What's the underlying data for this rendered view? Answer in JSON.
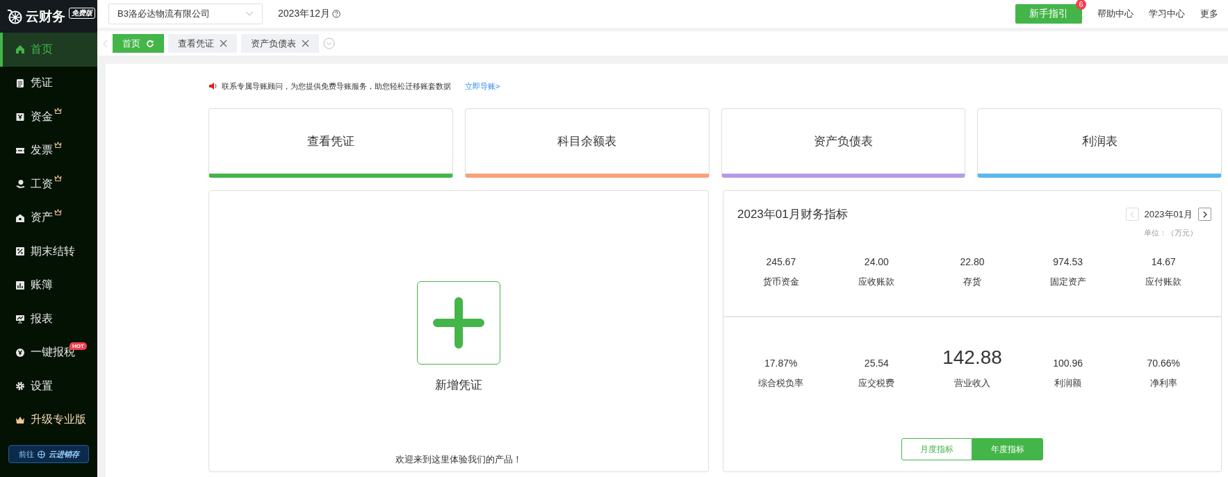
{
  "sidebar": {
    "logo_text": "云财务",
    "edition_badge": "免费版",
    "items": [
      {
        "label": "首页",
        "selected": true,
        "premium": false
      },
      {
        "label": "凭证",
        "selected": false,
        "premium": false
      },
      {
        "label": "资金",
        "selected": false,
        "premium": true
      },
      {
        "label": "发票",
        "selected": false,
        "premium": true
      },
      {
        "label": "工资",
        "selected": false,
        "premium": true
      },
      {
        "label": "资产",
        "selected": false,
        "premium": true
      },
      {
        "label": "期末结转",
        "selected": false,
        "premium": false
      },
      {
        "label": "账簿",
        "selected": false,
        "premium": false
      },
      {
        "label": "报表",
        "selected": false,
        "premium": false
      },
      {
        "label": "一键报税",
        "selected": false,
        "premium": false,
        "badge": "HOT"
      },
      {
        "label": "设置",
        "selected": false,
        "premium": false
      },
      {
        "label": "升级专业版",
        "selected": false,
        "premium": false,
        "kind": "upgrade"
      }
    ],
    "promo": {
      "prefix": "前往",
      "label": "云进销存"
    }
  },
  "topbar": {
    "company": "B3洛必达物流有限公司",
    "period": "2023年12月",
    "guide_button": "新手指引",
    "guide_badge": "6",
    "links": [
      "帮助中心",
      "学习中心",
      "更多"
    ]
  },
  "tabs": [
    {
      "label": "首页",
      "selected": true
    },
    {
      "label": "查看凭证",
      "selected": false
    },
    {
      "label": "资产负债表",
      "selected": false
    }
  ],
  "notice": {
    "text": "联系专属导账顾问，为您提供免费导账服务，助您轻松迁移账套数据",
    "link": "立即导账>"
  },
  "shortcuts": [
    {
      "label": "查看凭证",
      "color": "#44b549"
    },
    {
      "label": "科目余额表",
      "color": "#f8a27c"
    },
    {
      "label": "资产负债表",
      "color": "#b49be8"
    },
    {
      "label": "利润表",
      "color": "#5ab8f0"
    }
  ],
  "new_voucher": {
    "label": "新增凭证",
    "welcome": "欢迎来到这里体验我们的产品！"
  },
  "indicators": {
    "title": "2023年01月财务指标",
    "month": "2023年01月",
    "unit": "单位：（万元）",
    "rows": [
      [
        {
          "value": "245.67",
          "label": "货币资金",
          "emphasized": false
        },
        {
          "value": "24.00",
          "label": "应收账款",
          "emphasized": false
        },
        {
          "value": "22.80",
          "label": "存货",
          "emphasized": false
        },
        {
          "value": "974.53",
          "label": "固定资产",
          "emphasized": false
        },
        {
          "value": "14.67",
          "label": "应付账款",
          "emphasized": false
        }
      ],
      [
        {
          "value": "17.87%",
          "label": "综合税负率",
          "emphasized": false
        },
        {
          "value": "25.54",
          "label": "应交税费",
          "emphasized": false
        },
        {
          "value": "142.88",
          "label": "营业收入",
          "emphasized": true
        },
        {
          "value": "100.96",
          "label": "利润额",
          "emphasized": false
        },
        {
          "value": "70.66%",
          "label": "净利率",
          "emphasized": false
        }
      ]
    ],
    "toggle": [
      {
        "label": "月度指标",
        "selected": false
      },
      {
        "label": "年度指标",
        "selected": true
      }
    ]
  }
}
